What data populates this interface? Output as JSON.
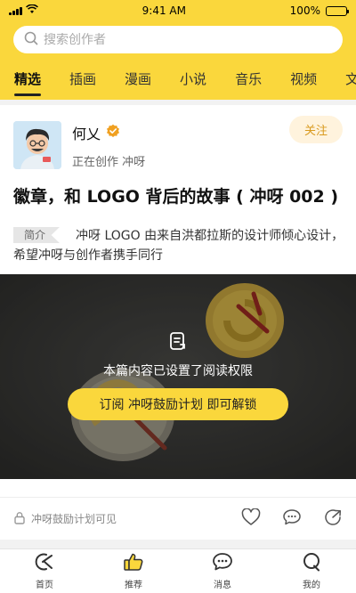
{
  "status_bar": {
    "time": "9:41 AM",
    "battery": "100%"
  },
  "search": {
    "placeholder": "搜索创作者"
  },
  "tabs": [
    {
      "label": "精选",
      "active": true
    },
    {
      "label": "插画"
    },
    {
      "label": "漫画"
    },
    {
      "label": "小说"
    },
    {
      "label": "音乐"
    },
    {
      "label": "视频"
    },
    {
      "label": "文章"
    }
  ],
  "post": {
    "author": {
      "name": "何乂",
      "subtitle": "正在创作 冲呀",
      "verified_icon": "verified-badge-icon"
    },
    "follow_label": "关注",
    "title": "徽章，和 LOGO 背后的故事 ( 冲呀 002 )",
    "intro_label": "简介",
    "intro_text": "冲呀 LOGO 由来自洪都拉斯的设计师倾心设计，希望冲呀与创作者携手同行",
    "locked_text": "本篇内容已设置了阅读权限",
    "unlock_label": "订阅 冲呀鼓励计划 即可解锁",
    "visibility_text": "冲呀鼓励计划可见",
    "action_icons": [
      "heart-icon",
      "comment-icon",
      "share-icon"
    ]
  },
  "bottom_nav": [
    {
      "label": "首页",
      "icon": "home-icon"
    },
    {
      "label": "推荐",
      "icon": "thumbs-up-icon"
    },
    {
      "label": "消息",
      "icon": "message-icon"
    },
    {
      "label": "我的",
      "icon": "profile-icon"
    }
  ],
  "colors": {
    "brand_yellow": "#fad73c",
    "follow_text": "#d99a1f",
    "verified": "#f0a020"
  }
}
